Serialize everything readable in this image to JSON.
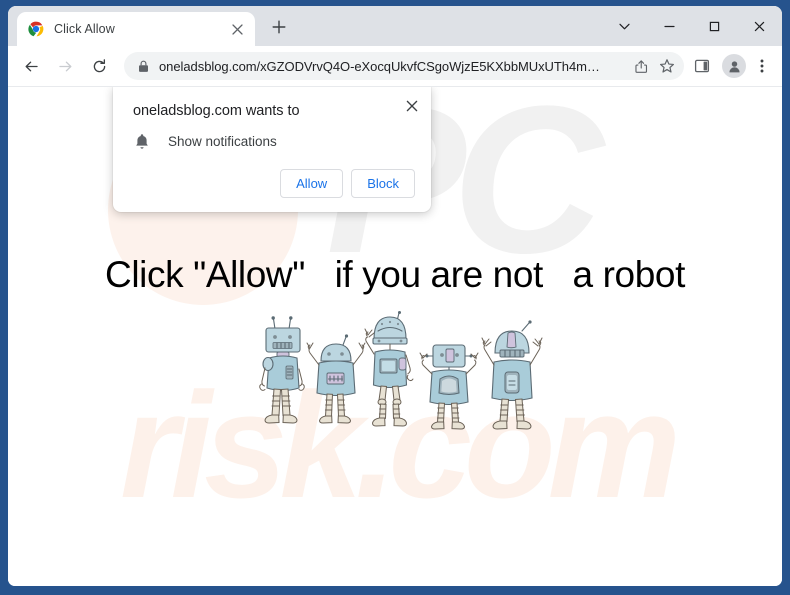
{
  "window": {
    "frame_color": "#26538D",
    "controls": [
      {
        "name": "tab-search",
        "glyph": "∨"
      },
      {
        "name": "minimize",
        "glyph": "−"
      },
      {
        "name": "maximize",
        "glyph": "□"
      },
      {
        "name": "close",
        "glyph": "×"
      }
    ]
  },
  "tab": {
    "title": "Click Allow",
    "favicon": "chrome-icon",
    "close_glyph": "×",
    "new_tab_glyph": "+"
  },
  "toolbar": {
    "back_label": "←",
    "forward_label": "→",
    "reload_label": "↻",
    "lock_icon": "lock-icon",
    "url": "oneladsblog.com/xGZODVrvQ4O-eXocqUkvfCSgoWjzE5KXbbMUxUTh4m…",
    "share_icon": "share-icon",
    "bookmark_icon": "star-icon",
    "side_panel_icon": "side-panel-icon",
    "profile_icon": "profile-avatar-icon",
    "menu_icon": "three-dot-menu-icon"
  },
  "dialog": {
    "title": "oneladsblog.com wants to",
    "permission_icon": "bell-icon",
    "permission_label": "Show notifications",
    "allow_label": "Allow",
    "block_label": "Block",
    "close_glyph": "×",
    "link_color": "#1a73e8"
  },
  "page": {
    "heading": "Click \"Allow\"   if you are not   a robot",
    "illustration": "five-cartoon-robots",
    "watermark_primary": "PC",
    "watermark_secondary": "risk.com",
    "watermark_primary_color": "#f1f1f1",
    "watermark_secondary_color": "#fdf1ea",
    "background_color": "#ffffff"
  }
}
